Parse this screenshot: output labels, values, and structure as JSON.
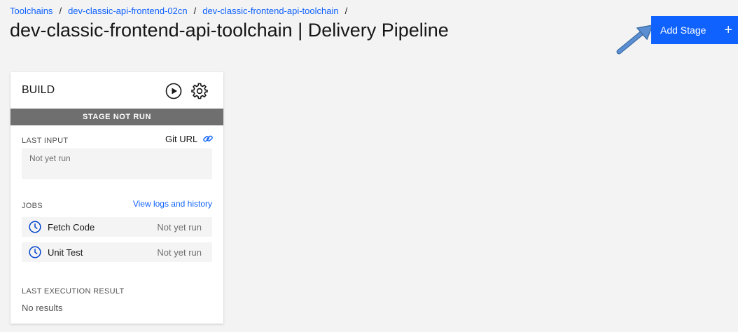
{
  "breadcrumb": {
    "items": [
      "Toolchains",
      "dev-classic-api-frontend-02cn",
      "dev-classic-frontend-api-toolchain"
    ],
    "separator": "/"
  },
  "page": {
    "title": "dev-classic-frontend-api-toolchain | Delivery Pipeline"
  },
  "actions": {
    "add_stage_label": "Add Stage",
    "add_stage_icon": "plus-icon"
  },
  "stage": {
    "name": "BUILD",
    "status": "STAGE NOT RUN",
    "last_input_label": "LAST INPUT",
    "git_url_label": "Git URL",
    "last_input_value": "Not yet run",
    "jobs_label": "JOBS",
    "logs_link": "View logs and history",
    "jobs": [
      {
        "name": "Fetch Code",
        "status": "Not yet run"
      },
      {
        "name": "Unit Test",
        "status": "Not yet run"
      }
    ],
    "last_result_label": "LAST EXECUTION RESULT",
    "last_result_value": "No results"
  },
  "colors": {
    "accent": "#0f62fe",
    "status_bar": "#6f6f6f",
    "background": "#f3f3f3",
    "arrow": "#5b8fd1"
  }
}
